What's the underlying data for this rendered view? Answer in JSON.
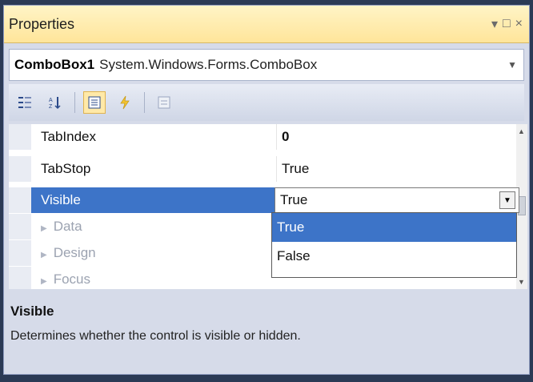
{
  "window": {
    "title": "Properties",
    "buttons": {
      "dropdown": "▾",
      "maximize": "□",
      "close": "×"
    }
  },
  "object_selector": {
    "name": "ComboBox1",
    "type": "System.Windows.Forms.ComboBox"
  },
  "toolbar": {
    "items": [
      "categorized-icon",
      "alphabetical-icon",
      "properties-icon",
      "events-icon",
      "property-pages-icon"
    ]
  },
  "properties": [
    {
      "name": "TabIndex",
      "value": "0",
      "bold": true
    },
    {
      "name": "TabStop",
      "value": "True"
    },
    {
      "name": "Visible",
      "value": "True",
      "selected": true
    }
  ],
  "categories": [
    "Data",
    "Design",
    "Focus"
  ],
  "dropdown": {
    "options": [
      "True",
      "False"
    ],
    "highlighted": "True"
  },
  "description": {
    "title": "Visible",
    "text": "Determines whether the control is visible or hidden."
  },
  "colors": {
    "selection": "#3d74c8",
    "titlebar": "#ffe59a"
  }
}
